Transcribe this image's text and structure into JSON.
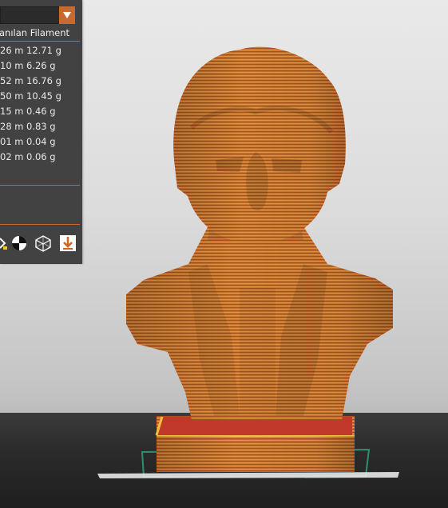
{
  "panel": {
    "header": "llanılan Filament",
    "rows": [
      {
        "length": "26 m",
        "weight": "12.71 g"
      },
      {
        "length": "10 m",
        "weight": "6.26 g"
      },
      {
        "length": "52 m",
        "weight": "16.76 g"
      },
      {
        "length": "50 m",
        "weight": "10.45 g"
      },
      {
        "length": "15 m",
        "weight": "0.46 g"
      },
      {
        "length": "28 m",
        "weight": "0.83 g"
      },
      {
        "length": "01 m",
        "weight": "0.04 g"
      },
      {
        "length": "02 m",
        "weight": "0.06 g"
      }
    ],
    "tools": [
      "partial-tool-icon",
      "color-scheme-icon",
      "wireframe-cube-icon",
      "export-download-icon"
    ]
  },
  "colors": {
    "accent": "#c8692f",
    "panel_bg": "#424242",
    "model_orange": "#d9732c",
    "base_red": "#c0392b"
  }
}
